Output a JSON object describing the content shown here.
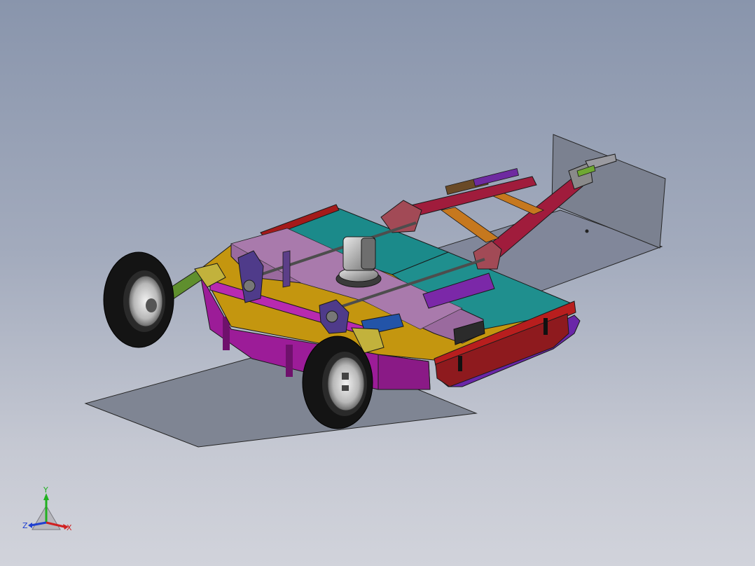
{
  "axis_triad": {
    "x_label": "X",
    "y_label": "Y",
    "z_label": "Z",
    "colors": {
      "x": "#d02020",
      "y": "#20b020",
      "z": "#2040d0"
    }
  },
  "model": {
    "icon": "mower-assembly-icon",
    "palette": {
      "deck_purple": "#9a6a9e",
      "deck_teal": "#1b8c8c",
      "deck_yellow": "#c69a14",
      "frame_red": "#a01c3c",
      "rear_red": "#8e1a1e",
      "skid_purple": "#6a26a8",
      "tire": "#141414",
      "plate_grey": "#7d8390"
    }
  }
}
